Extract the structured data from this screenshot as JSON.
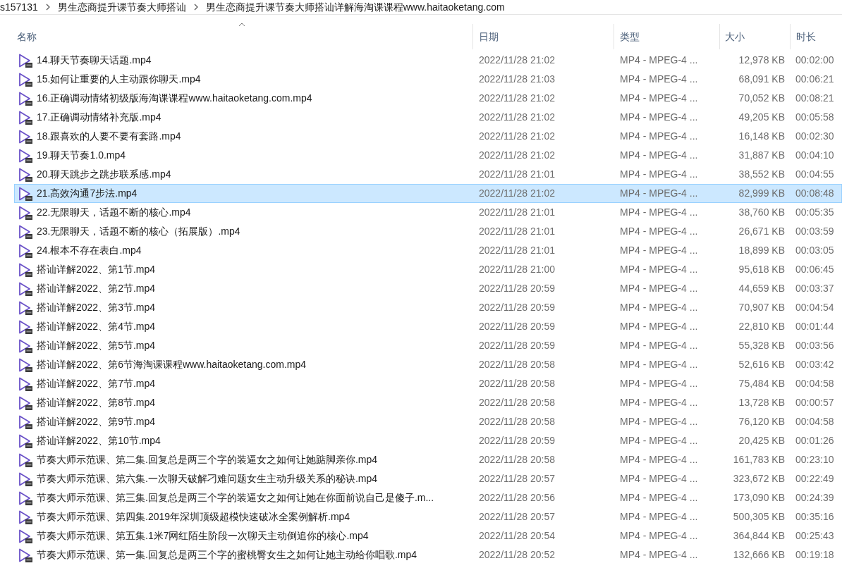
{
  "breadcrumb": [
    "s157131",
    "男生恋商提升课节奏大师搭讪",
    "男生恋商提升课节奏大师搭讪详解海淘课课程www.haitaoketang.com"
  ],
  "columns": [
    {
      "label": "名称",
      "sorted": true
    },
    {
      "label": "日期",
      "sorted": false
    },
    {
      "label": "类型",
      "sorted": false
    },
    {
      "label": "大小",
      "sorted": false
    },
    {
      "label": "时长",
      "sorted": false
    }
  ],
  "rows": [
    {
      "name": "14.聊天节奏聊天话题.mp4",
      "date": "2022/11/28 21:02",
      "type": "MP4 - MPEG-4 ...",
      "size": "12,978 KB",
      "duration": "00:02:00",
      "selected": false
    },
    {
      "name": "15.如何让重要的人主动跟你聊天.mp4",
      "date": "2022/11/28 21:03",
      "type": "MP4 - MPEG-4 ...",
      "size": "68,091 KB",
      "duration": "00:06:21",
      "selected": false
    },
    {
      "name": "16.正确调动情绪初级版海淘课课程www.haitaoketang.com.mp4",
      "date": "2022/11/28 21:02",
      "type": "MP4 - MPEG-4 ...",
      "size": "70,052 KB",
      "duration": "00:08:21",
      "selected": false
    },
    {
      "name": "17.正确调动情绪补充版.mp4",
      "date": "2022/11/28 21:02",
      "type": "MP4 - MPEG-4 ...",
      "size": "49,205 KB",
      "duration": "00:05:58",
      "selected": false
    },
    {
      "name": "18.跟喜欢的人要不要有套路.mp4",
      "date": "2022/11/28 21:02",
      "type": "MP4 - MPEG-4 ...",
      "size": "16,148 KB",
      "duration": "00:02:30",
      "selected": false
    },
    {
      "name": "19.聊天节奏1.0.mp4",
      "date": "2022/11/28 21:02",
      "type": "MP4 - MPEG-4 ...",
      "size": "31,887 KB",
      "duration": "00:04:10",
      "selected": false
    },
    {
      "name": "20.聊天跳步之跳步联系感.mp4",
      "date": "2022/11/28 21:01",
      "type": "MP4 - MPEG-4 ...",
      "size": "38,552 KB",
      "duration": "00:04:55",
      "selected": false
    },
    {
      "name": "21.高效沟通7步法.mp4",
      "date": "2022/11/28 21:02",
      "type": "MP4 - MPEG-4 ...",
      "size": "82,999 KB",
      "duration": "00:08:48",
      "selected": true
    },
    {
      "name": "22.无限聊天，话题不断的核心.mp4",
      "date": "2022/11/28 21:01",
      "type": "MP4 - MPEG-4 ...",
      "size": "38,760 KB",
      "duration": "00:05:35",
      "selected": false
    },
    {
      "name": "23.无限聊天，话题不断的核心（拓展版）.mp4",
      "date": "2022/11/28 21:01",
      "type": "MP4 - MPEG-4 ...",
      "size": "26,671 KB",
      "duration": "00:03:59",
      "selected": false
    },
    {
      "name": "24.根本不存在表白.mp4",
      "date": "2022/11/28 21:01",
      "type": "MP4 - MPEG-4 ...",
      "size": "18,899 KB",
      "duration": "00:03:05",
      "selected": false
    },
    {
      "name": "搭讪详解2022、第1节.mp4",
      "date": "2022/11/28 21:00",
      "type": "MP4 - MPEG-4 ...",
      "size": "95,618 KB",
      "duration": "00:06:45",
      "selected": false
    },
    {
      "name": "搭讪详解2022、第2节.mp4",
      "date": "2022/11/28 20:59",
      "type": "MP4 - MPEG-4 ...",
      "size": "44,659 KB",
      "duration": "00:03:37",
      "selected": false
    },
    {
      "name": "搭讪详解2022、第3节.mp4",
      "date": "2022/11/28 20:59",
      "type": "MP4 - MPEG-4 ...",
      "size": "70,907 KB",
      "duration": "00:04:54",
      "selected": false
    },
    {
      "name": "搭讪详解2022、第4节.mp4",
      "date": "2022/11/28 20:59",
      "type": "MP4 - MPEG-4 ...",
      "size": "22,810 KB",
      "duration": "00:01:44",
      "selected": false
    },
    {
      "name": "搭讪详解2022、第5节.mp4",
      "date": "2022/11/28 20:59",
      "type": "MP4 - MPEG-4 ...",
      "size": "55,328 KB",
      "duration": "00:03:56",
      "selected": false
    },
    {
      "name": "搭讪详解2022、第6节海淘课课程www.haitaoketang.com.mp4",
      "date": "2022/11/28 20:58",
      "type": "MP4 - MPEG-4 ...",
      "size": "52,616 KB",
      "duration": "00:03:42",
      "selected": false
    },
    {
      "name": "搭讪详解2022、第7节.mp4",
      "date": "2022/11/28 20:58",
      "type": "MP4 - MPEG-4 ...",
      "size": "75,484 KB",
      "duration": "00:04:58",
      "selected": false
    },
    {
      "name": "搭讪详解2022、第8节.mp4",
      "date": "2022/11/28 20:58",
      "type": "MP4 - MPEG-4 ...",
      "size": "13,728 KB",
      "duration": "00:00:57",
      "selected": false
    },
    {
      "name": "搭讪详解2022、第9节.mp4",
      "date": "2022/11/28 20:58",
      "type": "MP4 - MPEG-4 ...",
      "size": "76,120 KB",
      "duration": "00:04:58",
      "selected": false
    },
    {
      "name": "搭讪详解2022、第10节.mp4",
      "date": "2022/11/28 20:59",
      "type": "MP4 - MPEG-4 ...",
      "size": "20,425 KB",
      "duration": "00:01:26",
      "selected": false
    },
    {
      "name": "节奏大师示范课、第二集.回复总是两三个字的装逼女之如何让她踮脚亲你.mp4",
      "date": "2022/11/28 20:58",
      "type": "MP4 - MPEG-4 ...",
      "size": "161,783 KB",
      "duration": "00:23:10",
      "selected": false
    },
    {
      "name": "节奏大师示范课、第六集.一次聊天破解刁难问题女生主动升级关系的秘诀.mp4",
      "date": "2022/11/28 20:57",
      "type": "MP4 - MPEG-4 ...",
      "size": "323,672 KB",
      "duration": "00:22:49",
      "selected": false
    },
    {
      "name": "节奏大师示范课、第三集.回复总是两三个字的装逼女之如何让她在你面前说自己是傻子.m...",
      "date": "2022/11/28 20:56",
      "type": "MP4 - MPEG-4 ...",
      "size": "173,090 KB",
      "duration": "00:24:39",
      "selected": false
    },
    {
      "name": "节奏大师示范课、第四集.2019年深圳顶级超模快速破冰全案例解析.mp4",
      "date": "2022/11/28 20:57",
      "type": "MP4 - MPEG-4 ...",
      "size": "500,305 KB",
      "duration": "00:35:16",
      "selected": false
    },
    {
      "name": "节奏大师示范课、第五集.1米7网红陌生阶段一次聊天主动倒追你的核心.mp4",
      "date": "2022/11/28 20:54",
      "type": "MP4 - MPEG-4 ...",
      "size": "364,844 KB",
      "duration": "00:25:43",
      "selected": false
    },
    {
      "name": "节奏大师示范课、第一集.回复总是两三个字的蜜桃臀女生之如何让她主动给你唱歌.mp4",
      "date": "2022/11/28 20:52",
      "type": "MP4 - MPEG-4 ...",
      "size": "132,666 KB",
      "duration": "00:19:18",
      "selected": false
    }
  ]
}
